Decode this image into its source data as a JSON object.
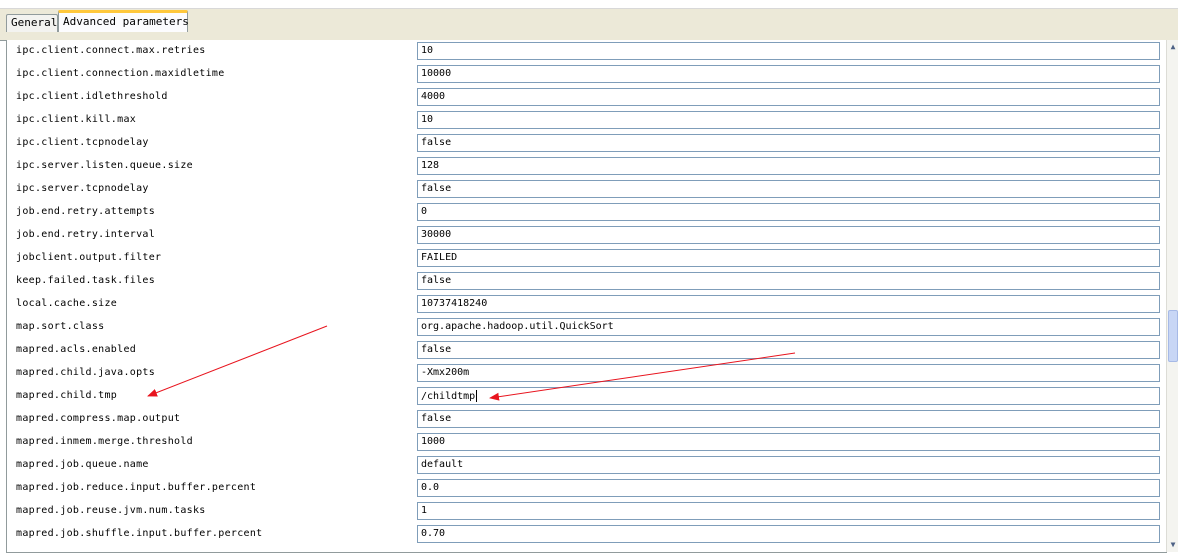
{
  "tabs": [
    {
      "label": "General",
      "active": false
    },
    {
      "label": "Advanced parameters",
      "active": true
    }
  ],
  "parameters": [
    {
      "name": "ipc.client.connect.max.retries",
      "value": "10"
    },
    {
      "name": "ipc.client.connection.maxidletime",
      "value": "10000"
    },
    {
      "name": "ipc.client.idlethreshold",
      "value": "4000"
    },
    {
      "name": "ipc.client.kill.max",
      "value": "10"
    },
    {
      "name": "ipc.client.tcpnodelay",
      "value": "false"
    },
    {
      "name": "ipc.server.listen.queue.size",
      "value": "128"
    },
    {
      "name": "ipc.server.tcpnodelay",
      "value": "false"
    },
    {
      "name": "job.end.retry.attempts",
      "value": "0"
    },
    {
      "name": "job.end.retry.interval",
      "value": "30000"
    },
    {
      "name": "jobclient.output.filter",
      "value": "FAILED"
    },
    {
      "name": "keep.failed.task.files",
      "value": "false"
    },
    {
      "name": "local.cache.size",
      "value": "10737418240"
    },
    {
      "name": "map.sort.class",
      "value": "org.apache.hadoop.util.QuickSort"
    },
    {
      "name": "mapred.acls.enabled",
      "value": "false"
    },
    {
      "name": "mapred.child.java.opts",
      "value": "-Xmx200m"
    },
    {
      "name": "mapred.child.tmp",
      "value": "/childtmp"
    },
    {
      "name": "mapred.compress.map.output",
      "value": "false"
    },
    {
      "name": "mapred.inmem.merge.threshold",
      "value": "1000"
    },
    {
      "name": "mapred.job.queue.name",
      "value": "default"
    },
    {
      "name": "mapred.job.reduce.input.buffer.percent",
      "value": "0.0"
    },
    {
      "name": "mapred.job.reuse.jvm.num.tasks",
      "value": "1"
    },
    {
      "name": "mapred.job.shuffle.input.buffer.percent",
      "value": "0.70"
    }
  ],
  "focused_field": "mapred.child.tmp",
  "annotation_color": "#e8141e",
  "scrollbar": {
    "up_icon": "scroll-up-arrow-icon",
    "down_icon": "scroll-down-arrow-icon"
  }
}
